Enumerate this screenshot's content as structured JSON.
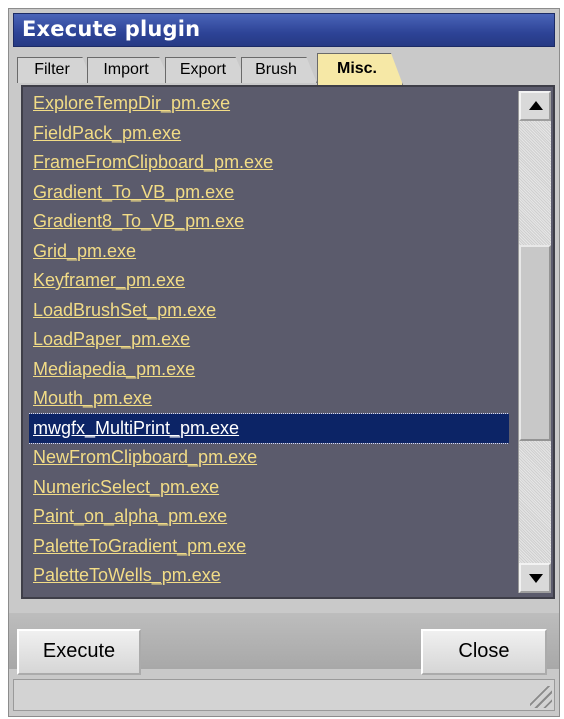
{
  "window": {
    "title": "Execute plugin"
  },
  "tabs": [
    {
      "label": "Filter"
    },
    {
      "label": "Import"
    },
    {
      "label": "Export"
    },
    {
      "label": "Brush"
    },
    {
      "label": "Misc."
    }
  ],
  "active_tab": "Misc.",
  "list": {
    "items": [
      "ExploreTempDir_pm.exe",
      "FieldPack_pm.exe",
      "FrameFromClipboard_pm.exe",
      "Gradient_To_VB_pm.exe",
      "Gradient8_To_VB_pm.exe",
      "Grid_pm.exe",
      "Keyframer_pm.exe",
      "LoadBrushSet_pm.exe",
      "LoadPaper_pm.exe",
      "Mediapedia_pm.exe",
      "Mouth_pm.exe",
      "mwgfx_MultiPrint_pm.exe",
      "NewFromClipboard_pm.exe",
      "NumericSelect_pm.exe",
      "Paint_on_alpha_pm.exe",
      "PaletteToGradient_pm.exe",
      "PaletteToWells_pm.exe"
    ],
    "selected": "mwgfx_MultiPrint_pm.exe"
  },
  "buttons": {
    "execute_label": "Execute",
    "close_label": "Close"
  },
  "colors": {
    "title_bar": "#2d4396",
    "list_background": "#5b5b6c",
    "link_text": "#f2dc86",
    "selection": "#0c2466",
    "active_tab": "#f6e8a6"
  }
}
